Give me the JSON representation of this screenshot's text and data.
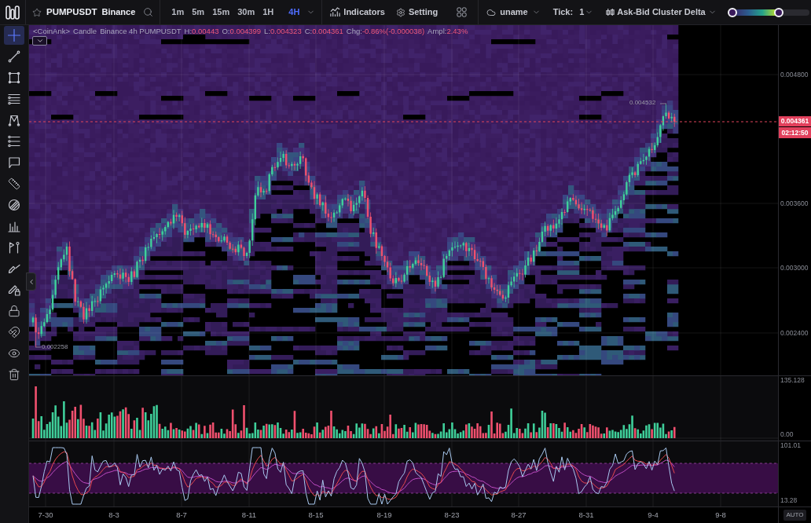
{
  "top_bar": {
    "favorited": false,
    "symbol": "PUMPUSDT",
    "exchange": "Binance",
    "timeframes": [
      {
        "label": "1m",
        "selected": false
      },
      {
        "label": "5m",
        "selected": false
      },
      {
        "label": "15m",
        "selected": false
      },
      {
        "label": "30m",
        "selected": false
      },
      {
        "label": "1H",
        "selected": false
      },
      {
        "label": "4H",
        "selected": true
      }
    ],
    "indicators": "Indicators",
    "setting": "Setting",
    "user": "uname",
    "tick_label": "Tick:",
    "tick_value": "1",
    "mode": "Ask-Bid Cluster Delta",
    "color_range": {
      "handles": [
        {
          "level": 0
        },
        {
          "level": 0.6
        }
      ]
    }
  },
  "tools": [
    {
      "kind": "crosshair",
      "selected": true
    },
    {
      "kind": "trend-line",
      "selected": false
    },
    {
      "kind": "rectangle",
      "selected": false
    },
    {
      "kind": "parallel-lines",
      "selected": false
    },
    {
      "kind": "pattern",
      "selected": false
    },
    {
      "kind": "fib",
      "selected": false
    },
    {
      "kind": "note",
      "selected": false
    },
    {
      "kind": "ruler",
      "selected": false
    },
    {
      "kind": "hatch",
      "selected": false
    },
    {
      "kind": "histogram",
      "selected": false
    },
    {
      "kind": "flag",
      "selected": false
    },
    {
      "kind": "brush",
      "selected": false
    },
    {
      "kind": "pencil-lock",
      "selected": false
    },
    {
      "kind": "lock",
      "selected": false
    },
    {
      "kind": "magnet",
      "selected": false
    },
    {
      "kind": "eye",
      "selected": false
    },
    {
      "kind": "trash",
      "selected": false
    }
  ],
  "chart": {
    "legend": {
      "source": "<CoinAnk>",
      "type": "Candle",
      "instrument": "Binance 4h PUMPUSDT",
      "stats": [
        {
          "label": "H:",
          "value": "0.00443"
        },
        {
          "label": "O:",
          "value": "0.004399"
        },
        {
          "label": "L:",
          "value": "0.004323"
        },
        {
          "label": "C:",
          "value": "0.004361"
        },
        {
          "label": "Chg:",
          "value": "-0.86%(-0.000038)"
        },
        {
          "label": "Ampl:",
          "value": "2.43%"
        }
      ]
    },
    "high_marker": "0.004532",
    "low_marker": "0.002258",
    "price_axis": [
      "0.004800",
      "0.003600",
      "0.003000",
      "0.002400"
    ],
    "last_price": "0.004361",
    "countdown": "02:12:50"
  },
  "volume_pane": {
    "axis": [
      "135.128",
      "0.00"
    ]
  },
  "oscillator_pane": {
    "axis": [
      "101.01",
      "13.28"
    ]
  },
  "time_axis": {
    "dates": [
      "7-30",
      "8-3",
      "8-7",
      "8-11",
      "8-15",
      "8-19",
      "8-23",
      "8-27",
      "8-31",
      "9-4",
      "9-8"
    ],
    "auto_button": "AUTO"
  }
}
